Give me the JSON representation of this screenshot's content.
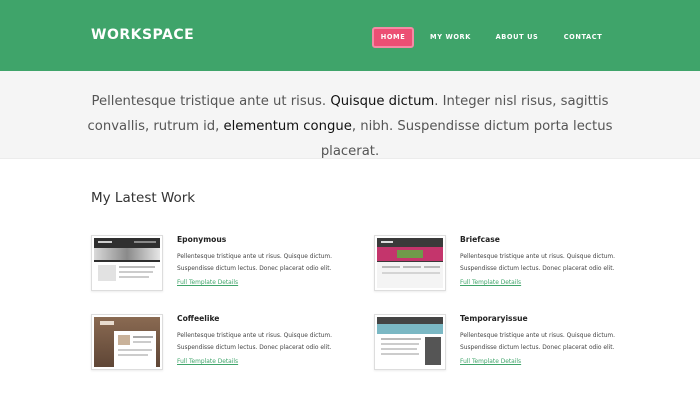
{
  "header": {
    "logo": "WORKSPACE",
    "nav": [
      {
        "label": "HOME",
        "active": true
      },
      {
        "label": "MY WORK",
        "active": false
      },
      {
        "label": "ABOUT US",
        "active": false
      },
      {
        "label": "CONTACT",
        "active": false
      }
    ]
  },
  "banner": {
    "part1": "Pellentesque tristique ante ut risus. ",
    "bold1": "Quisque dictum",
    "part2": ". Integer nisl risus, sagittis convallis, rutrum id, ",
    "bold2": "elementum congue",
    "part3": ", nibh. Suspendisse dictum porta lectus placerat."
  },
  "section": {
    "title": "My Latest Work",
    "works": [
      {
        "title": "Eponymous",
        "desc": "Pellentesque tristique ante ut risus. Quisque dictum. Suspendisse dictum lectus. Donec placerat odio elit.",
        "link": "Full Template Details"
      },
      {
        "title": "Briefcase",
        "desc": "Pellentesque tristique ante ut risus. Quisque dictum. Suspendisse dictum lectus. Donec placerat odio elit.",
        "link": "Full Template Details"
      },
      {
        "title": "Coffeelike",
        "desc": "Pellentesque tristique ante ut risus. Quisque dictum. Suspendisse dictum lectus. Donec placerat odio elit.",
        "link": "Full Template Details"
      },
      {
        "title": "Temporaryissue",
        "desc": "Pellentesque tristique ante ut risus. Quisque dictum. Suspendisse dictum lectus. Donec placerat odio elit.",
        "link": "Full Template Details"
      }
    ]
  },
  "colors": {
    "header_bg": "#3fa46a",
    "active_nav": "#ec4f74",
    "link": "#3fa46a"
  }
}
